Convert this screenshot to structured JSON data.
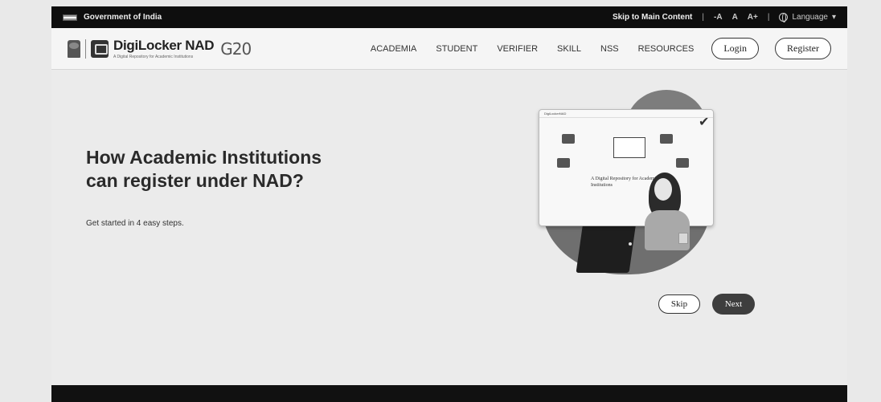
{
  "gov_bar": {
    "title": "Government of India",
    "skip_link": "Skip to Main Content",
    "font_decrease": "-A",
    "font_normal": "A",
    "font_increase": "A+",
    "language": "Language"
  },
  "header": {
    "brand_name": "DigiLocker NAD",
    "brand_tagline": "A Digital Repository for Academic Institutions",
    "g20_mark": "G20",
    "nav": [
      "ACADEMIA",
      "STUDENT",
      "VERIFIER",
      "SKILL",
      "NSS",
      "RESOURCES"
    ],
    "login_label": "Login",
    "register_label": "Register"
  },
  "hero": {
    "title": "How Academic Institutions can register under NAD?",
    "subtitle": "Get started in 4 easy steps.",
    "illustration": {
      "screen_brand": "DigiLockerNAD",
      "screen_headline": "A Digital Repository for Academic Institutions"
    },
    "skip_label": "Skip",
    "next_label": "Next"
  },
  "colors": {
    "gov_bar_bg": "#0e0e0e",
    "header_bg": "#f5f5f5",
    "hero_bg": "#ebebeb",
    "next_button_bg": "#3e3e3e"
  }
}
